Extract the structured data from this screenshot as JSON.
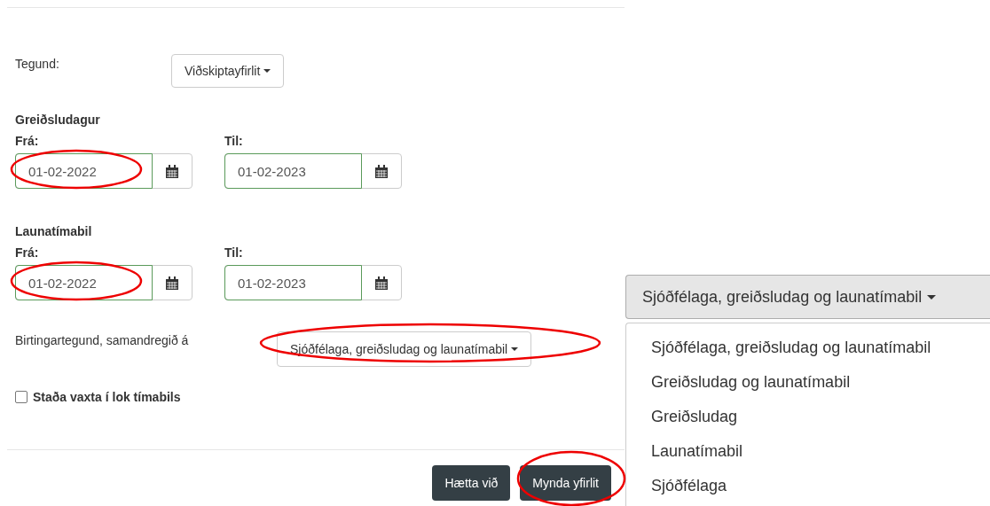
{
  "type_field": {
    "label": "Tegund:",
    "value": "Viðskiptayfirlit"
  },
  "date_groups": [
    {
      "title": "Greiðsludagur",
      "from": {
        "label": "Frá:",
        "value": "01-02-2022",
        "circled": true
      },
      "to": {
        "label": "Til:",
        "value": "01-02-2023",
        "circled": false
      }
    },
    {
      "title": "Launatímabil",
      "from": {
        "label": "Frá:",
        "value": "01-02-2022",
        "circled": true
      },
      "to": {
        "label": "Til:",
        "value": "01-02-2023",
        "circled": false
      }
    }
  ],
  "display_field": {
    "label": "Birtingartegund, samandregið á",
    "value": "Sjóðfélaga, greiðsludag og launatímabil",
    "circled": true
  },
  "checkbox": {
    "label": "Staða vaxta í lok tímabils",
    "checked": false
  },
  "buttons": [
    {
      "label": "Hætta við",
      "circled": false
    },
    {
      "label": "Mynda yfirlit",
      "circled": true
    }
  ],
  "open_dropdown": {
    "value": "Sjóðfélaga, greiðsludag og launatímabil",
    "options": [
      {
        "label": "Sjóðfélaga, greiðsludag og launatímabil"
      },
      {
        "label": "Greiðsludag og launatímabil"
      },
      {
        "label": "Greiðsludag"
      },
      {
        "label": "Launatímabil"
      },
      {
        "label": "Sjóðfélaga"
      }
    ]
  }
}
